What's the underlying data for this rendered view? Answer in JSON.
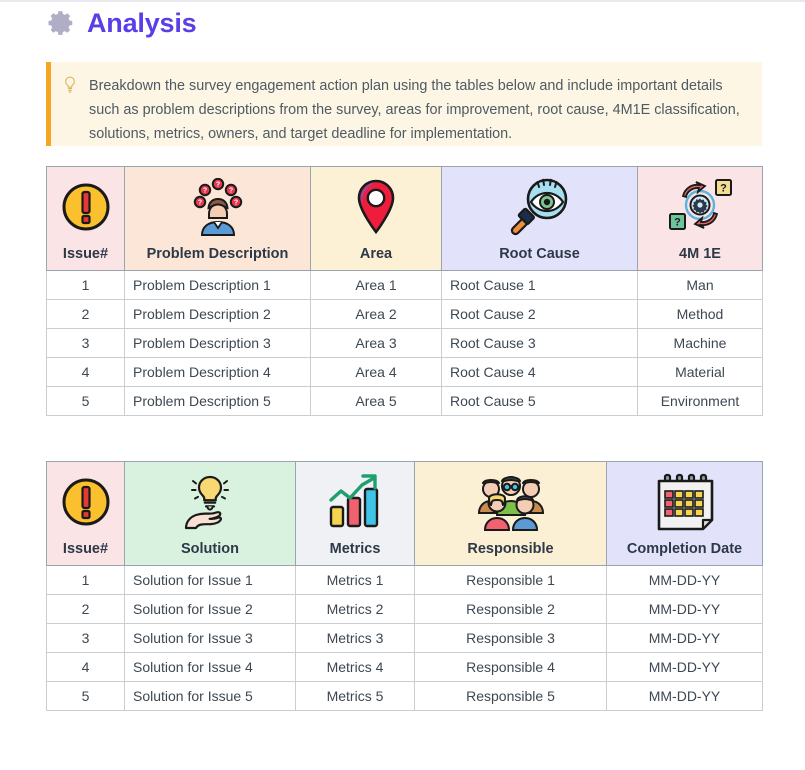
{
  "header": {
    "icon": "gear-icon",
    "title": "Analysis"
  },
  "callout": {
    "icon": "lightbulb-icon",
    "text": "Breakdown the survey engagement action plan using the tables below and include important details such as problem descriptions from the survey, areas for improvement, root cause, 4M1E classification, solutions, metrics, owners, and target deadline for implementation.",
    "accent_color": "#f5a623",
    "background_color": "#fdf6e4"
  },
  "tables": [
    {
      "name": "issue-analysis-table",
      "columns": [
        {
          "label": "Issue#",
          "icon": "exclamation-circle-icon",
          "bg": "#fbe4e6",
          "align": "center"
        },
        {
          "label": "Problem Description",
          "icon": "person-questions-icon",
          "bg": "#fbe6d8",
          "align": "left"
        },
        {
          "label": "Area",
          "icon": "map-pin-icon",
          "bg": "#fcf1d4",
          "align": "center"
        },
        {
          "label": "Root Cause",
          "icon": "magnifier-eye-icon",
          "bg": "#e2e3fb",
          "align": "left"
        },
        {
          "label": "4M 1E",
          "icon": "gear-arrows-question-icon",
          "bg": "#fbe4e6",
          "align": "center"
        }
      ],
      "rows": [
        [
          "1",
          "Problem Description 1",
          "Area 1",
          "Root Cause 1",
          "Man"
        ],
        [
          "2",
          "Problem Description 2",
          "Area 2",
          "Root Cause 2",
          "Method"
        ],
        [
          "3",
          "Problem Description 3",
          "Area 3",
          "Root Cause 3",
          "Machine"
        ],
        [
          "4",
          "Problem Description 4",
          "Area 4",
          "Root Cause 4",
          "Material"
        ],
        [
          "5",
          "Problem Description 5",
          "Area 5",
          "Root Cause 5",
          "Environment"
        ]
      ]
    },
    {
      "name": "solution-plan-table",
      "columns": [
        {
          "label": "Issue#",
          "icon": "exclamation-circle-icon",
          "bg": "#fbe4e6",
          "align": "center"
        },
        {
          "label": "Solution",
          "icon": "lightbulb-hand-icon",
          "bg": "#d9f2df",
          "align": "left"
        },
        {
          "label": "Metrics",
          "icon": "bar-chart-growth-icon",
          "bg": "#f0f1f4",
          "align": "center"
        },
        {
          "label": "Responsible",
          "icon": "people-group-icon",
          "bg": "#fcf0d4",
          "align": "center"
        },
        {
          "label": "Completion Date",
          "icon": "calendar-icon",
          "bg": "#e2e3fb",
          "align": "center"
        }
      ],
      "rows": [
        [
          "1",
          "Solution for Issue 1",
          "Metrics 1",
          "Responsible 1",
          "MM-DD-YY"
        ],
        [
          "2",
          "Solution for Issue 2",
          "Metrics 2",
          "Responsible 2",
          "MM-DD-YY"
        ],
        [
          "3",
          "Solution for Issue 3",
          "Metrics 3",
          "Responsible 3",
          "MM-DD-YY"
        ],
        [
          "4",
          "Solution for Issue 4",
          "Metrics 4",
          "Responsible 4",
          "MM-DD-YY"
        ],
        [
          "5",
          "Solution for Issue 5",
          "Metrics 5",
          "Responsible 5",
          "MM-DD-YY"
        ]
      ]
    }
  ]
}
